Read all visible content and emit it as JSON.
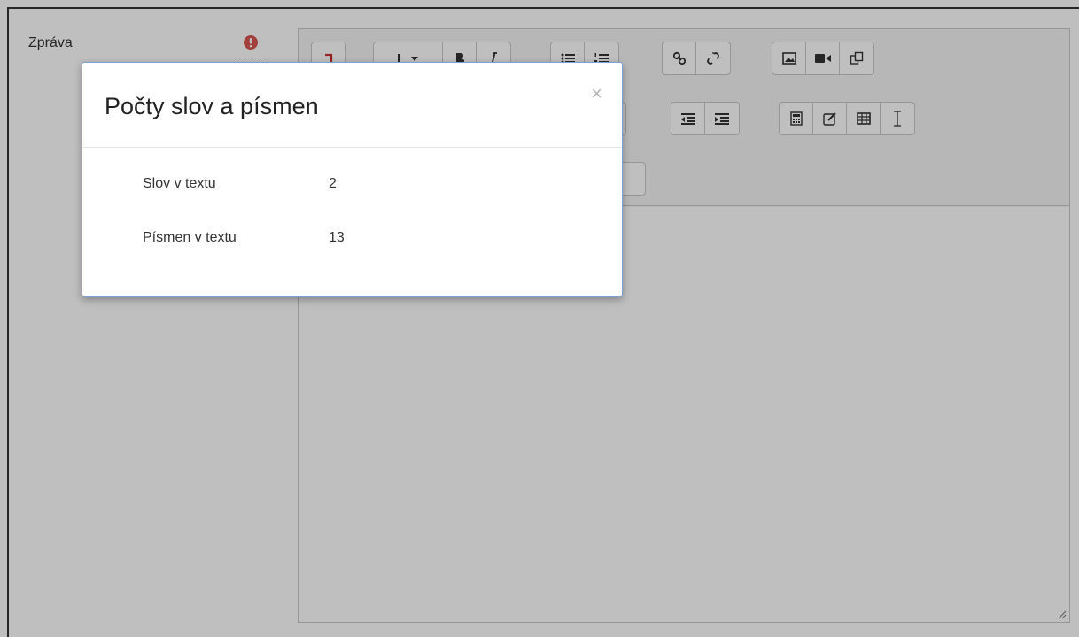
{
  "form": {
    "message_label": "Zpráva"
  },
  "dialog": {
    "title": "Počty slov a písmen",
    "close_symbol": "×",
    "rows": [
      {
        "label": "Slov v textu",
        "value": "2"
      },
      {
        "label": "Písmen v textu",
        "value": "13"
      }
    ]
  },
  "icons": {
    "required": "exclamation-circle-icon",
    "resize": "resize-handle-icon"
  },
  "colors": {
    "required_red": "#d9534f",
    "modal_border": "#7ea1d6",
    "backdrop": "rgba(0,0,0,0.25)"
  }
}
